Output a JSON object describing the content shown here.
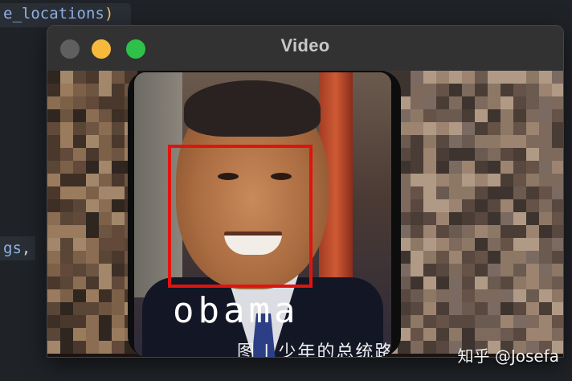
{
  "editor": {
    "line1": "e_locations",
    "line1_paren": ")",
    "line2": "gs",
    "line2_comma": ","
  },
  "window": {
    "title": "Video",
    "buttons": {
      "close": "close-button",
      "minimize": "minimize-button",
      "maximize": "maximize-button"
    },
    "colors": {
      "close": "#5f5f5f",
      "minimize": "#f6b93b",
      "maximize": "#2fc04a"
    }
  },
  "video": {
    "detection_label": "obama",
    "box_color": "#e0140f",
    "caption_cn": "图 | 少年的总统路"
  },
  "watermark": {
    "text": "知乎 @Josefa"
  }
}
